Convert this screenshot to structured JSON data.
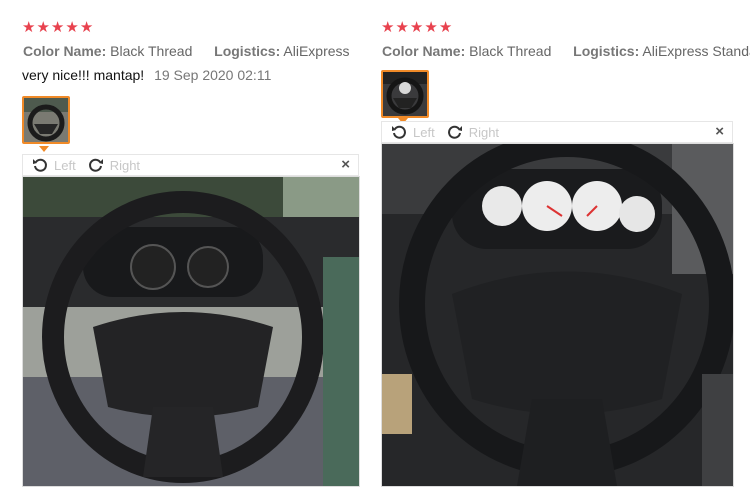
{
  "reviews": [
    {
      "rating": 5,
      "meta": {
        "color_key": "Color Name:",
        "color_value": "Black Thread",
        "logistics_key": "Logistics:",
        "logistics_value": "AliExpress"
      },
      "comment": "very nice!!! mantap!",
      "date": "19 Sep 2020 02:11",
      "toolbar": {
        "rotate_left": "Left",
        "rotate_right": "Right",
        "close": "×"
      }
    },
    {
      "rating": 5,
      "meta": {
        "color_key": "Color Name:",
        "color_value": "Black Thread",
        "logistics_key": "Logistics:",
        "logistics_value": "AliExpress Standard"
      },
      "toolbar": {
        "rotate_left": "Left",
        "rotate_right": "Right",
        "close": "×"
      }
    }
  ],
  "icons": {
    "star": "star-icon",
    "rotate_left": "rotate-left-icon",
    "rotate_right": "rotate-right-icon",
    "close": "close-icon"
  },
  "colors": {
    "star": "#e8424e",
    "thumb_border": "#f08a28",
    "disabled_tool_text": "#c7c7c7"
  }
}
